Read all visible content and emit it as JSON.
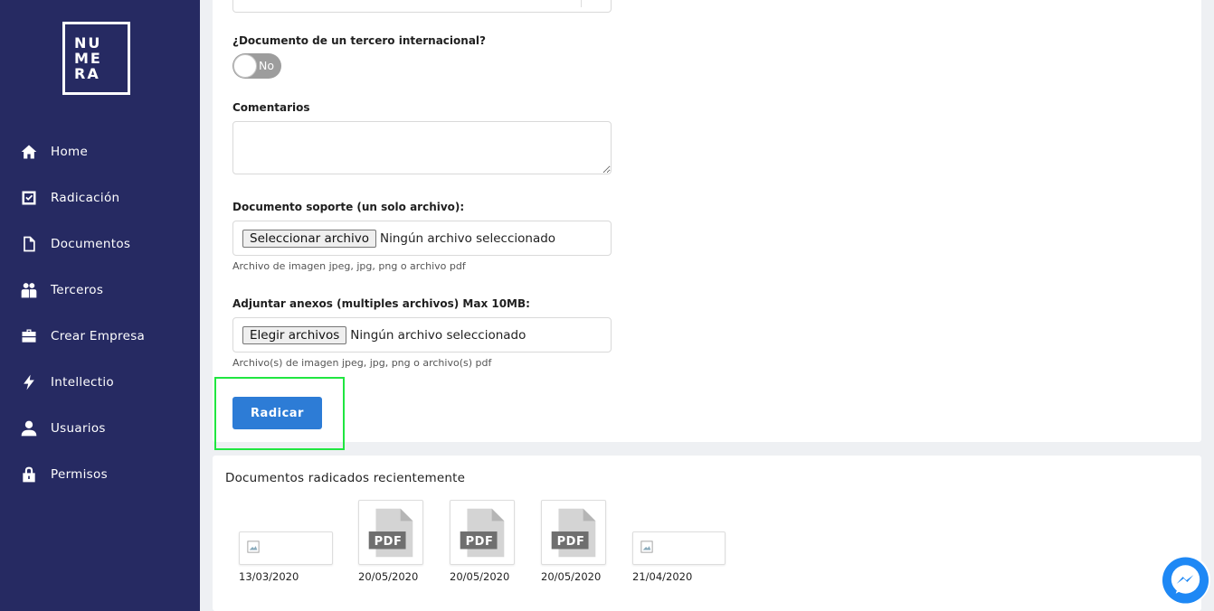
{
  "sidebar": {
    "logo_lines": [
      "NU",
      "ME",
      "RA"
    ],
    "items": [
      {
        "label": "Home",
        "icon": "home-icon"
      },
      {
        "label": "Radicación",
        "icon": "checkbox-icon"
      },
      {
        "label": "Documentos",
        "icon": "document-icon"
      },
      {
        "label": "Terceros",
        "icon": "people-icon"
      },
      {
        "label": "Crear Empresa",
        "icon": "briefcase-icon"
      },
      {
        "label": "Intellectio",
        "icon": "bolt-icon"
      },
      {
        "label": "Usuarios",
        "icon": "user-icon"
      },
      {
        "label": "Permisos",
        "icon": "lock-icon"
      }
    ]
  },
  "form": {
    "tercero_label": "¿Documento de un tercero internacional?",
    "tercero_toggle": "No",
    "comentarios_label": "Comentarios",
    "soporte_label": "Documento soporte (un solo archivo):",
    "soporte_button": "Seleccionar archivo",
    "soporte_status": "Ningún archivo seleccionado",
    "soporte_hint": "Archivo de imagen jpeg, jpg, png o archivo pdf",
    "anexos_label": "Adjuntar anexos (multiples archivos) Max 10MB:",
    "anexos_button": "Elegir archivos",
    "anexos_status": "Ningún archivo seleccionado",
    "anexos_hint": "Archivo(s) de imagen jpeg, jpg, png o archivo(s) pdf",
    "submit_label": "Radicar"
  },
  "recent": {
    "title": "Documentos radicados recientemente",
    "docs": [
      {
        "type": "image",
        "date": "13/03/2020"
      },
      {
        "type": "pdf",
        "badge": "PDF",
        "date": "20/05/2020"
      },
      {
        "type": "pdf",
        "badge": "PDF",
        "date": "20/05/2020"
      },
      {
        "type": "pdf",
        "badge": "PDF",
        "date": "20/05/2020"
      },
      {
        "type": "image",
        "date": "21/04/2020"
      }
    ]
  },
  "colors": {
    "sidebar": "#262a62",
    "accent": "#2d7cd6",
    "highlight": "#20e640",
    "messenger": "#1e88f5"
  }
}
